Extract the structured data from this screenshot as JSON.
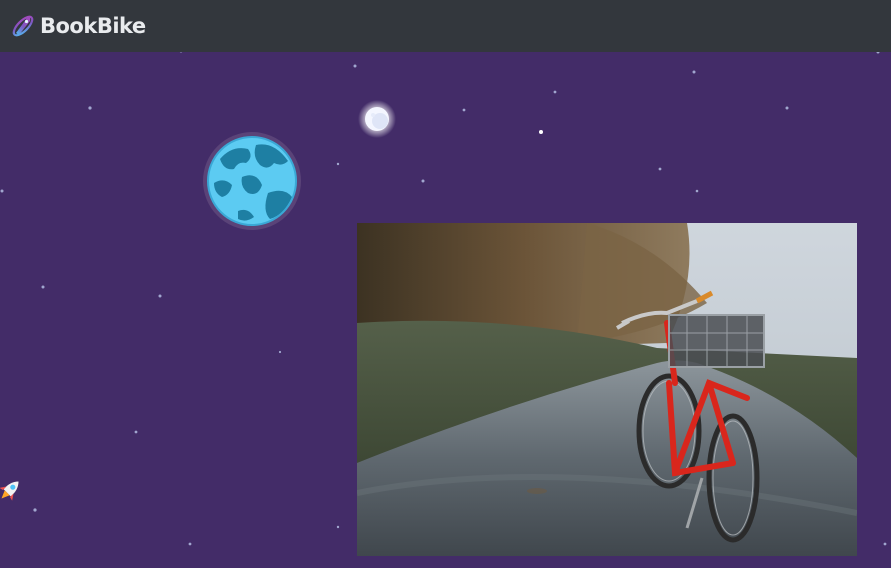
{
  "app": {
    "name": "BookBike"
  },
  "icons": {
    "logo": "rocket-orbit-logo",
    "planet": "earth-planet",
    "moon": "full-moon",
    "rocket": "rocket"
  },
  "hero_image": {
    "subject": "red-bicycle-with-basket-on-path"
  },
  "colors": {
    "header_bg": "#33373d",
    "page_bg": "#432c68",
    "brand_text": "#e9ebee"
  }
}
